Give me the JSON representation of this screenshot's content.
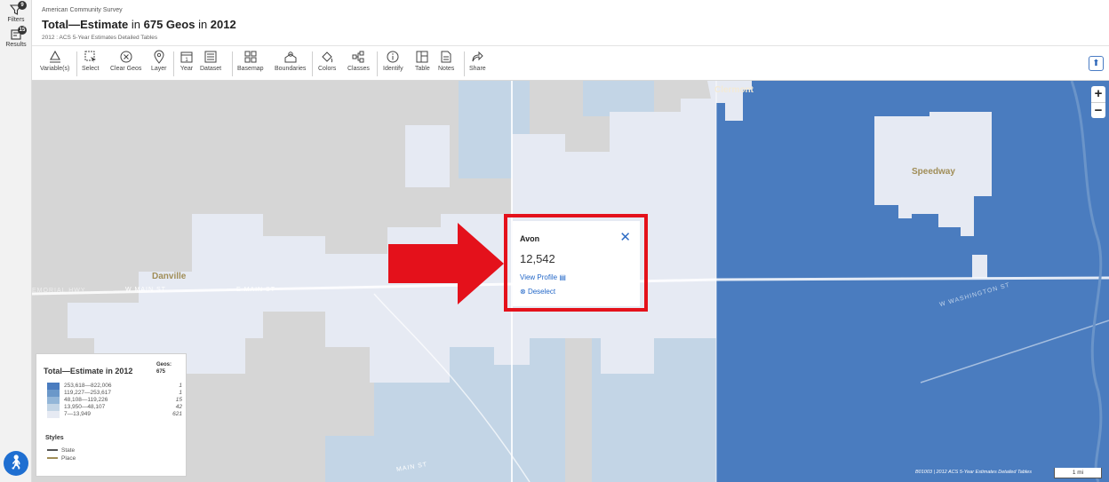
{
  "rail": {
    "filters_label": "Filters",
    "filters_badge": "9",
    "results_label": "Results",
    "results_badge": "15"
  },
  "header": {
    "survey": "American Community Survey",
    "title_part1": "Total—Estimate",
    "title_part2": " in ",
    "title_geos": "675 Geos",
    "title_part3": " in ",
    "title_year": "2012",
    "subtitle": "2012 : ACS 5-Year Estimates Detailed Tables"
  },
  "toolbar": {
    "items": [
      {
        "label": "Variable(s)",
        "icon": "variables-icon"
      },
      {
        "label": "Select",
        "icon": "select-icon"
      },
      {
        "label": "Clear Geos",
        "icon": "clear-icon"
      },
      {
        "label": "Layer",
        "icon": "layer-icon"
      },
      {
        "label": "Year",
        "icon": "calendar-icon"
      },
      {
        "label": "Dataset",
        "icon": "dataset-icon"
      },
      {
        "label": "Basemap",
        "icon": "basemap-icon"
      },
      {
        "label": "Boundaries",
        "icon": "boundaries-icon"
      },
      {
        "label": "Colors",
        "icon": "colors-icon"
      },
      {
        "label": "Classes",
        "icon": "classes-icon"
      },
      {
        "label": "Identify",
        "icon": "info-icon"
      },
      {
        "label": "Table",
        "icon": "table-icon"
      },
      {
        "label": "Notes",
        "icon": "notes-icon"
      },
      {
        "label": "Share",
        "icon": "share-icon"
      }
    ],
    "collapse_icon": "chevron-up-icon"
  },
  "map": {
    "places": {
      "clermont": "Clermont",
      "speedway": "Speedway",
      "danville": "Danville"
    },
    "roads": {
      "memorial_hwy": "EMORIAL HWY",
      "w_main_st": "W MAIN ST",
      "main_st2": "E MAIN ST",
      "w_washington_st": "W WASHINGTON ST",
      "main_st_bottom": "MAIN ST"
    },
    "zoom_in": "+",
    "zoom_out": "−",
    "colors": {
      "dark": "#4a7cbf",
      "light": "#e6eaf3",
      "mid": "#c3d5e6",
      "basemap": "#d6d6d6"
    }
  },
  "popup": {
    "name": "Avon",
    "value": "12,542",
    "view_profile": "View Profile",
    "deselect": "Deselect"
  },
  "legend": {
    "title": "Total—Estimate in 2012",
    "geos_label": "Geos:",
    "geos_count": "675",
    "rows": [
      {
        "range": "253,618—822,006",
        "count": "1",
        "color": "#4a7cbf"
      },
      {
        "range": "119,227—253,617",
        "count": "1",
        "color": "#6b98c9"
      },
      {
        "range": "48,108—119,226",
        "count": "15",
        "color": "#93b6d8"
      },
      {
        "range": "13,950—48,107",
        "count": "42",
        "color": "#c3d5e6"
      },
      {
        "range": "7—13,949",
        "count": "621",
        "color": "#e6eaf3"
      }
    ],
    "styles_title": "Styles",
    "style_state": "State",
    "style_place": "Place"
  },
  "attribution": "B01003 | 2012 ACS 5-Year Estimates Detailed Tables",
  "scale": "1 mi"
}
